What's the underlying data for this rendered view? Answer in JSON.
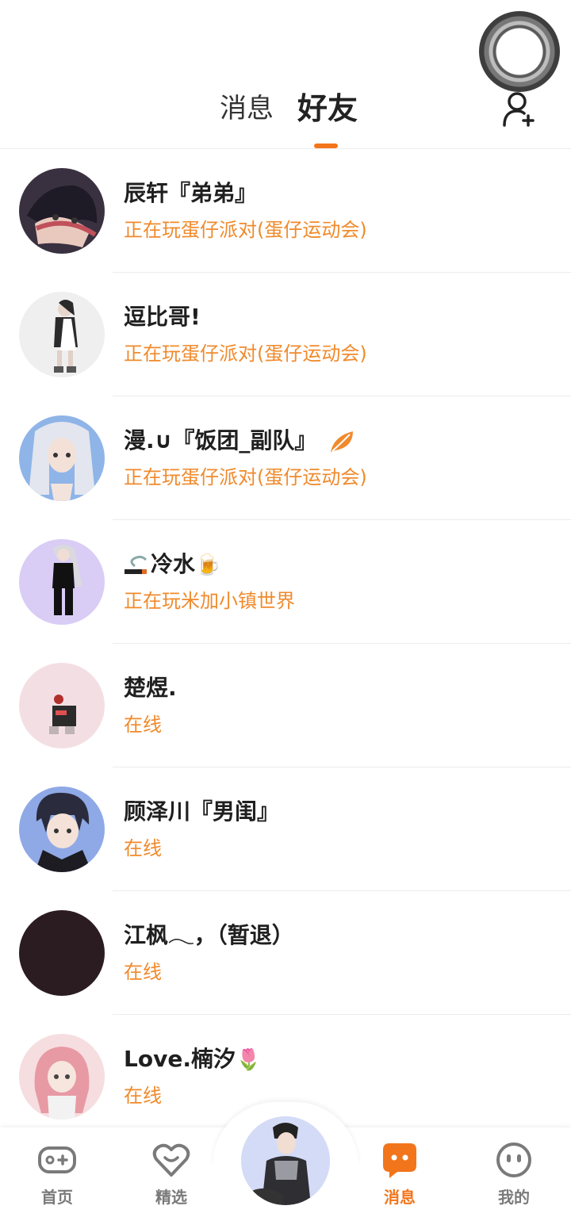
{
  "header": {
    "tabs": [
      {
        "label": "消息",
        "active": false
      },
      {
        "label": "好友",
        "active": true
      }
    ],
    "accent": "#f2751c"
  },
  "friends": [
    {
      "name": "辰轩『弟弟』",
      "status": "正在玩蛋仔派对(蛋仔运动会)",
      "avatar_bg": "#3a3140"
    },
    {
      "name": "逗比哥!",
      "status": "正在玩蛋仔派对(蛋仔运动会)",
      "avatar_bg": "#efefef"
    },
    {
      "name": "漫.∪『饭团_副队』",
      "status": "正在玩蛋仔派对(蛋仔运动会)",
      "avatar_bg": "#8fb4e8",
      "badge": "leaf-icon"
    },
    {
      "name": "冷水",
      "status": "正在玩米加小镇世界",
      "avatar_bg": "#d9ccf5",
      "prefix_icon": "smoking-icon",
      "suffix_icon": "beer-icon"
    },
    {
      "name": "楚煜.",
      "status": "在线",
      "avatar_bg": "#f3dfe3"
    },
    {
      "name": "顾泽川『男闺』",
      "status": "在线",
      "avatar_bg": "#8fa9e6"
    },
    {
      "name": "江枫𓂃，（暂退）",
      "status": "在线",
      "avatar_bg": "#2b1c22"
    },
    {
      "name": "Love.楠汐",
      "status": "在线",
      "avatar_bg": "#f6dde0",
      "suffix_icon": "tulip-icon"
    }
  ],
  "icons": {
    "tulip": "🌷",
    "beer": "🍺"
  },
  "bottom_nav": [
    {
      "label": "首页",
      "icon": "gamepad-icon",
      "active": false
    },
    {
      "label": "精选",
      "icon": "heart-chat-icon",
      "active": false
    },
    {
      "label": "消息",
      "icon": "message-icon",
      "active": true
    },
    {
      "label": "我的",
      "icon": "face-icon",
      "active": false
    }
  ]
}
